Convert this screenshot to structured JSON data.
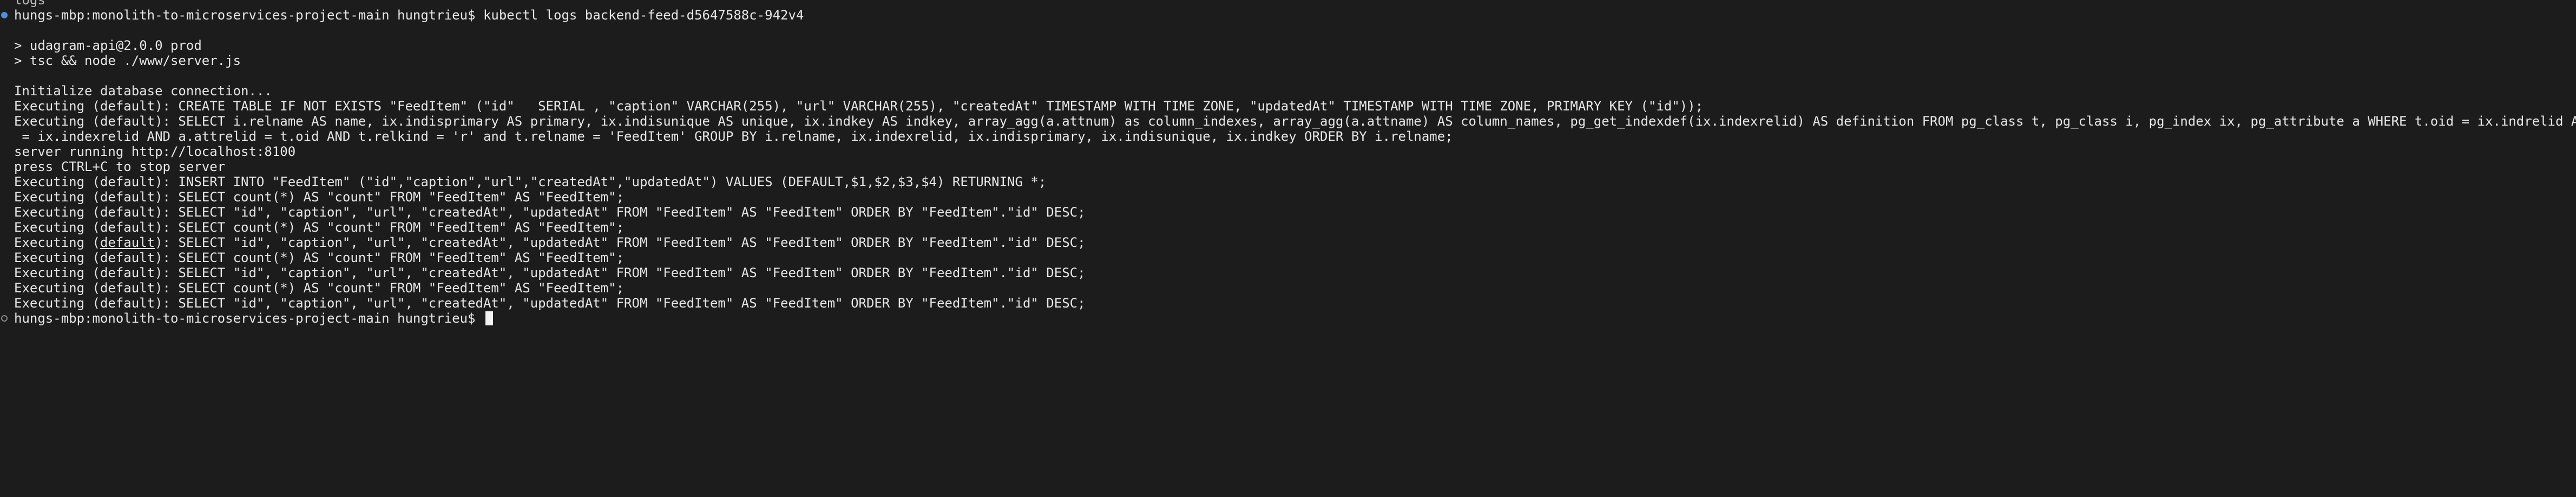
{
  "terminal": {
    "clipped_top": "logs",
    "prompt_1": "hungs-mbp:monolith-to-microservices-project-main hungtrieu$ kubectl logs backend-feed-d5647588c-942v4",
    "npm_line_1": "> udagram-api@2.0.0 prod",
    "npm_line_2": "> tsc && node ./www/server.js",
    "init_line": "Initialize database connection...",
    "exec_create": "Executing (default): CREATE TABLE IF NOT EXISTS \"FeedItem\" (\"id\"   SERIAL , \"caption\" VARCHAR(255), \"url\" VARCHAR(255), \"createdAt\" TIMESTAMP WITH TIME ZONE, \"updatedAt\" TIMESTAMP WITH TIME ZONE, PRIMARY KEY (\"id\"));",
    "exec_index_1": "Executing (default): SELECT i.relname AS name, ix.indisprimary AS primary, ix.indisunique AS unique, ix.indkey AS indkey, array_agg(a.attnum) as column_indexes, array_agg(a.attname) AS column_names, pg_get_indexdef(ix.indexrelid) AS definition FROM pg_class t, pg_class i, pg_index ix, pg_attribute a WHERE t.oid = ix.indrelid AND i.oid",
    "exec_index_2": " = ix.indexrelid AND a.attrelid = t.oid AND t.relkind = 'r' and t.relname = 'FeedItem' GROUP BY i.relname, ix.indexrelid, ix.indisprimary, ix.indisunique, ix.indkey ORDER BY i.relname;",
    "server_running": "server running http://localhost:8100",
    "press_stop": "press CTRL+C to stop server",
    "exec_insert": "Executing (default): INSERT INTO \"FeedItem\" (\"id\",\"caption\",\"url\",\"createdAt\",\"updatedAt\") VALUES (DEFAULT,$1,$2,$3,$4) RETURNING *;",
    "exec_count": "Executing (default): SELECT count(*) AS \"count\" FROM \"FeedItem\" AS \"FeedItem\";",
    "exec_select": "Executing (default): SELECT \"id\", \"caption\", \"url\", \"createdAt\", \"updatedAt\" FROM \"FeedItem\" AS \"FeedItem\" ORDER BY \"FeedItem\".\"id\" DESC;",
    "exec_prefix": "Executing (",
    "exec_default_word": "default",
    "exec_select_suffix": "): SELECT \"id\", \"caption\", \"url\", \"createdAt\", \"updatedAt\" FROM \"FeedItem\" AS \"FeedItem\" ORDER BY \"FeedItem\".\"id\" DESC;",
    "prompt_2": "hungs-mbp:monolith-to-microservices-project-main hungtrieu$ "
  },
  "colors": {
    "background": "#1c1c1c",
    "foreground": "#e6e6e6",
    "mark_active": "#4f90d9",
    "mark_idle": "#8a8a8a"
  }
}
